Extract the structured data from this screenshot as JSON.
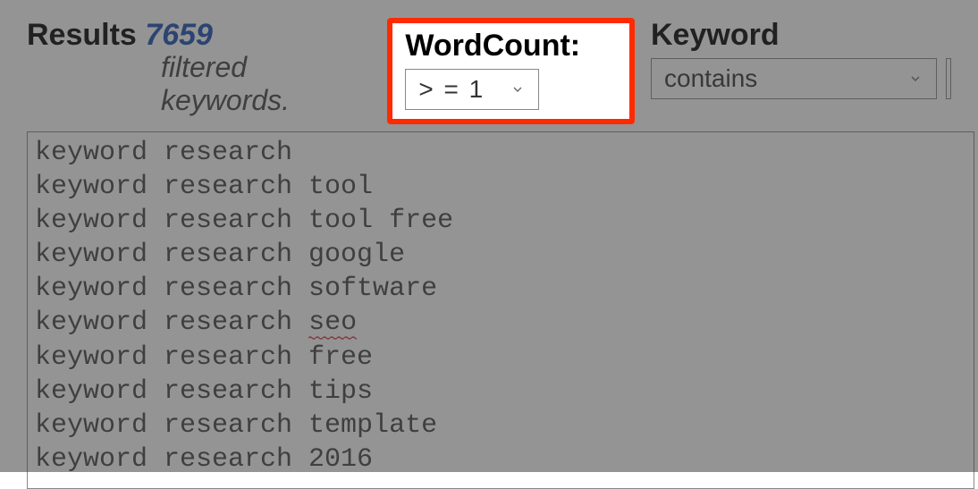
{
  "results": {
    "label": "Results",
    "count": "7659",
    "filtered_label": "filtered keywords."
  },
  "wordcount": {
    "label": "WordCount:",
    "selected": "> = 1"
  },
  "keyword_filter": {
    "label": "Keyword",
    "selected": "contains"
  },
  "keywords": [
    "keyword research",
    "keyword research tool",
    "keyword research tool free",
    "keyword research google",
    "keyword research software",
    "keyword research seo",
    "keyword research free",
    "keyword research tips",
    "keyword research template",
    "keyword research 2016"
  ],
  "spellcheck_line_index": 5,
  "spellcheck_word": "seo"
}
